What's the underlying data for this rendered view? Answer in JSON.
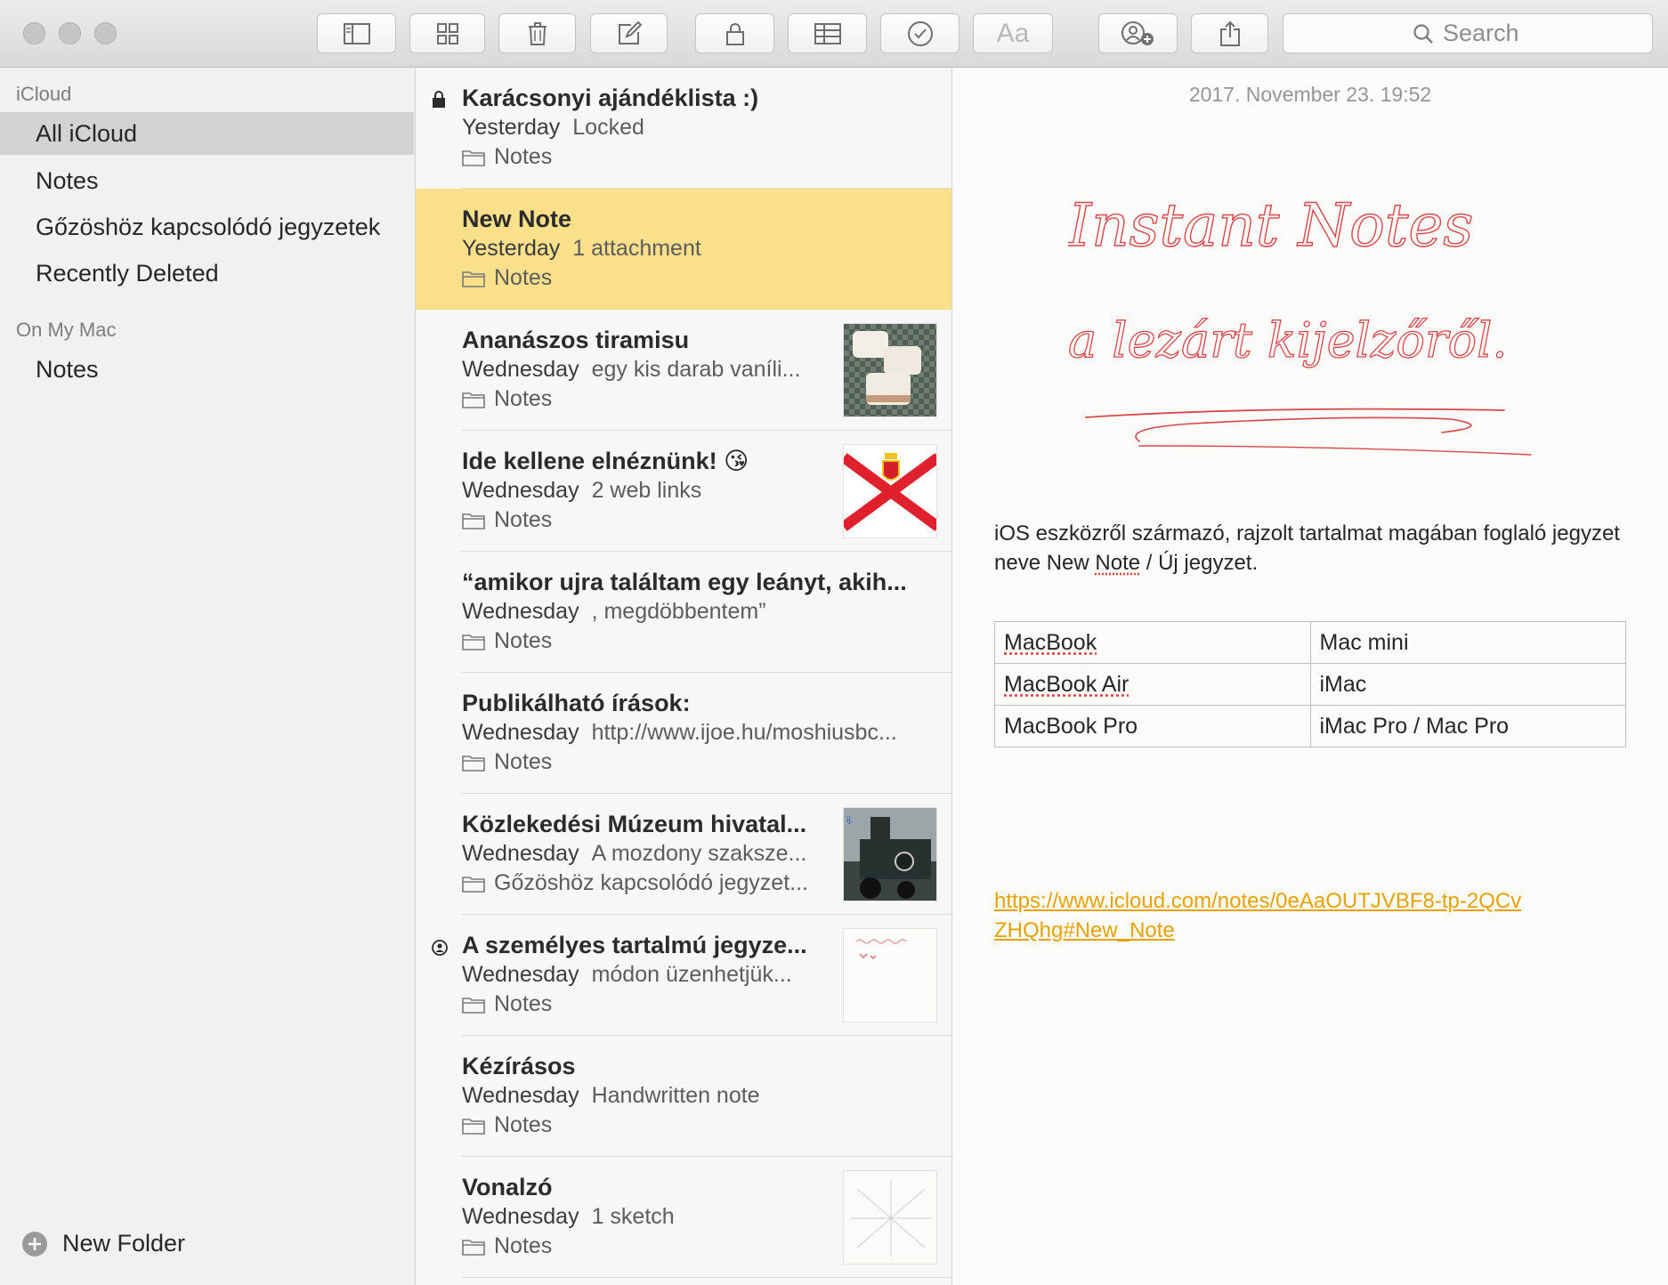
{
  "toolbar": {
    "aa_label": "Aa",
    "search_placeholder": "Search"
  },
  "sidebar": {
    "sections": [
      {
        "title": "iCloud",
        "folders": [
          "All iCloud",
          "Notes",
          "Gőzöshöz kapcsolódó jegyzetek",
          "Recently Deleted"
        ]
      },
      {
        "title": "On My Mac",
        "folders": [
          "Notes"
        ]
      }
    ],
    "selected": "All iCloud",
    "new_folder": "New Folder"
  },
  "notes": [
    {
      "title": "Karácsonyi ajándéklista :)",
      "date": "Yesterday",
      "snippet": "Locked",
      "folder": "Notes",
      "lead_icon": "lock-icon"
    },
    {
      "title": "New Note",
      "date": "Yesterday",
      "snippet": "1 attachment",
      "folder": "Notes",
      "selected": true
    },
    {
      "title": "Ananászos tiramisu",
      "date": "Wednesday",
      "snippet": "egy kis darab vaníli...",
      "folder": "Notes",
      "thumbnail": "tiramisu-photo"
    },
    {
      "title": "Ide kellene elnéznünk! 😘",
      "date": "Wednesday",
      "snippet": "2 web links",
      "folder": "Notes",
      "thumbnail": "jersey-flag"
    },
    {
      "title": "“amikor ujra találtam egy leányt, akih...",
      "date": "Wednesday",
      "snippet": ", megdöbbentem”",
      "folder": "Notes"
    },
    {
      "title": "Publikálható írások:",
      "date": "Wednesday",
      "snippet": "http://www.ijoe.hu/moshiusbc...",
      "folder": "Notes"
    },
    {
      "title": "Közlekedési Múzeum hivatal...",
      "date": "Wednesday",
      "snippet": "A mozdony szaksze...",
      "folder": "Gőzöshöz kapcsolódó jegyzet...",
      "thumbnail": "locomotive-photo"
    },
    {
      "title": "A személyes tartalmú jegyze...",
      "date": "Wednesday",
      "snippet": "módon üzenhetjük...",
      "folder": "Notes",
      "lead_icon": "shared-person-icon",
      "thumbnail": "handwriting-thumb"
    },
    {
      "title": "Kézírásos",
      "date": "Wednesday",
      "snippet": "Handwritten note",
      "folder": "Notes"
    },
    {
      "title": "Vonalzó",
      "date": "Wednesday",
      "snippet": "1 sketch",
      "folder": "Notes",
      "thumbnail": "sketch-thumb"
    }
  ],
  "editor": {
    "timestamp": "2017. November 23. 19:52",
    "handwriting_line1": "Instant Notes",
    "handwriting_line2": "a lezárt kijelzőről.",
    "body_part1": "iOS eszközről származó, rajzolt tartalmat magában foglaló jegyzet neve New ",
    "body_note_word": "Note",
    "body_part2": " / Új jegyzet.",
    "table": [
      [
        "MacBook",
        "Mac mini"
      ],
      [
        "MacBook Air",
        "iMac"
      ],
      [
        "MacBook Pro",
        "iMac Pro / Mac Pro"
      ]
    ],
    "link": "https://www.icloud.com/notes/0eAaOUTJVBF8-tp-2QCvZHQhg#New_Note"
  },
  "colors": {
    "selected_note": "#fbe08c",
    "link": "#e8a200",
    "handwriting": "#d9474c"
  }
}
